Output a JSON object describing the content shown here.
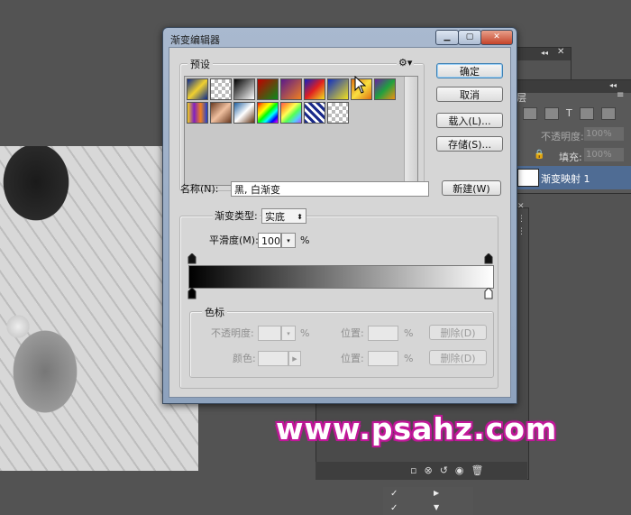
{
  "dialog": {
    "title": "渐变编辑器",
    "window_buttons": [
      "minimize-icon",
      "maximize-icon",
      "close-icon"
    ],
    "presets": {
      "group_label": "预设",
      "gear_icon": "gear-icon",
      "swatches": [
        {
          "name": "blue-yellow-blue",
          "css": "linear-gradient(135deg,#0b2a8f,#f0d030,#0b2a8f)"
        },
        {
          "name": "transparent-stripes",
          "css": "repeating-conic-gradient(#bbb 0 25%,#fff 0 50%) 0 0/8px 8px"
        },
        {
          "name": "black-white",
          "css": "linear-gradient(135deg,#000,#fff)"
        },
        {
          "name": "red-green",
          "css": "linear-gradient(135deg,#c00000,#0a8a1a)"
        },
        {
          "name": "violet-orange",
          "css": "linear-gradient(135deg,#5a1a8a,#f08020)"
        },
        {
          "name": "blue-red-yellow",
          "css": "linear-gradient(135deg,#1020c0,#e02020,#f0e020)"
        },
        {
          "name": "blue-yellow",
          "css": "linear-gradient(135deg,#1030c0,#f0e020)"
        },
        {
          "name": "orange-yellow-orange",
          "css": "linear-gradient(135deg,#e07010,#f8e040,#e07010)"
        },
        {
          "name": "violet-green-orange",
          "css": "linear-gradient(135deg,#6a20a0,#20a040,#f09010)"
        },
        {
          "name": "yellow-violet-orange-blue",
          "css": "linear-gradient(90deg,#f0d020,#8020c0,#f08020,#2040d0)"
        },
        {
          "name": "copper",
          "css": "linear-gradient(135deg,#6a3a20,#f0c0a0,#6a3a20)"
        },
        {
          "name": "chrome",
          "css": "linear-gradient(135deg,#2060a0,#fff,#603010)"
        },
        {
          "name": "spectrum",
          "css": "linear-gradient(135deg,red,orange,yellow,lime,cyan,blue,magenta)"
        },
        {
          "name": "transparent-rainbow",
          "css": "linear-gradient(135deg,#f55,#fa3,#ff5,#5f5,#5cf,#a5f)"
        },
        {
          "name": "transparent-stripes-diagonal",
          "css": "repeating-linear-gradient(45deg,#1a2a8a 0 3px,#fff 3px 6px)"
        },
        {
          "name": "neutral-density",
          "css": "repeating-conic-gradient(#bbb 0 25%,#fff 0 50%) 0 0/8px 8px"
        }
      ]
    },
    "buttons": {
      "ok": "确定",
      "cancel": "取消",
      "load": "载入(L)...",
      "save": "存储(S)...",
      "new": "新建(W)"
    },
    "name": {
      "label": "名称(N):",
      "value": "黑, 白渐变"
    },
    "gradient_type": {
      "label": "渐变类型:",
      "value": "实底"
    },
    "smoothness": {
      "label": "平滑度(M):",
      "value": "100",
      "unit": "%"
    },
    "color_stops": {
      "group_label": "色标",
      "opacity_label": "不透明度:",
      "opacity_unit": "%",
      "location_label": "位置:",
      "location_unit": "%",
      "color_label": "颜色:",
      "delete_label": "删除(D)"
    },
    "colors": {
      "title_bar": "#9fb3cd",
      "client": "#d6d6d6",
      "accent": "#3c7fb1"
    }
  },
  "layers_panel": {
    "opacity_label": "不透明度:",
    "opacity_value": "100%",
    "fill_label": "填充:",
    "fill_value": "100%",
    "layer_name": "渐变映射 1",
    "tab_fragment": "层"
  },
  "watermark": "www.psahz.com"
}
